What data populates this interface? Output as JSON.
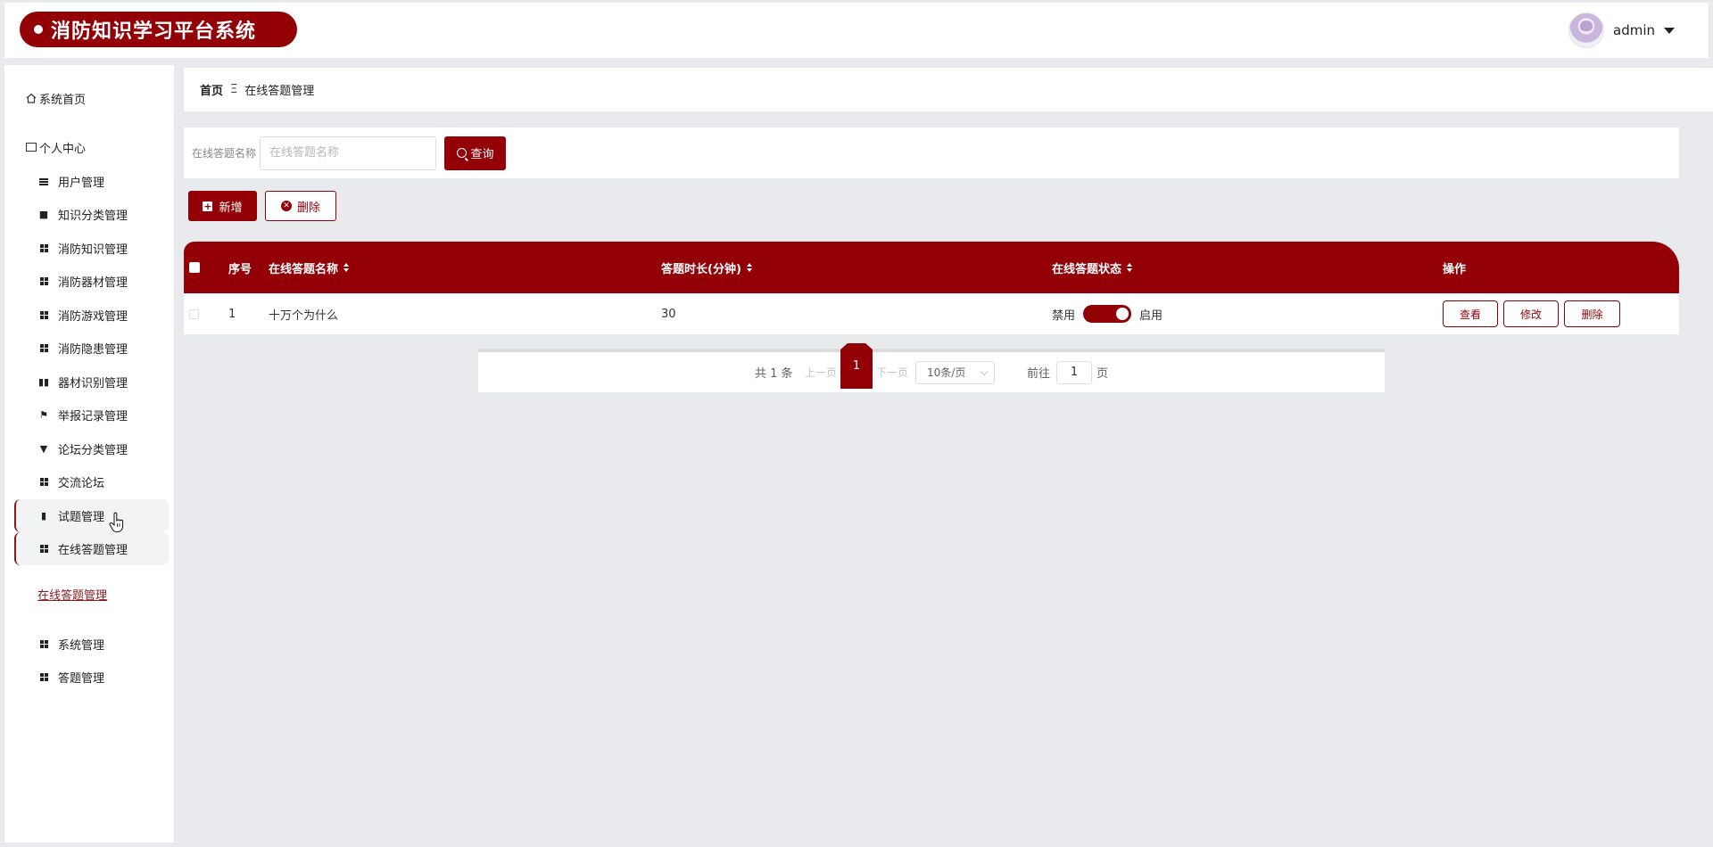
{
  "app": {
    "title": "消防知识学习平台系统"
  },
  "user": {
    "name": "admin"
  },
  "sidebar": {
    "home": "系统首页",
    "personal_center": "个人中心",
    "items": [
      {
        "label": "用户管理",
        "icon": "list-icon"
      },
      {
        "label": "知识分类管理",
        "icon": "folder-icon"
      },
      {
        "label": "消防知识管理",
        "icon": "grid-icon"
      },
      {
        "label": "消防器材管理",
        "icon": "grid-icon"
      },
      {
        "label": "消防游戏管理",
        "icon": "grid-icon"
      },
      {
        "label": "消防隐患管理",
        "icon": "grid-icon"
      },
      {
        "label": "器材识别管理",
        "icon": "chart-icon"
      },
      {
        "label": "举报记录管理",
        "icon": "flag-icon"
      },
      {
        "label": "论坛分类管理",
        "icon": "bookmark-icon"
      },
      {
        "label": "交流论坛",
        "icon": "grid-icon"
      },
      {
        "label": "试题管理",
        "icon": "bar-chart-icon"
      },
      {
        "label": "在线答题管理",
        "icon": "grid-icon"
      }
    ],
    "sub_link": "在线答题管理",
    "bottom_items": [
      {
        "label": "系统管理",
        "icon": "grid-icon"
      },
      {
        "label": "答题管理",
        "icon": "grid-icon"
      }
    ]
  },
  "breadcrumb": {
    "home": "首页",
    "separator": "Ξ",
    "current": "在线答题管理"
  },
  "search": {
    "label": "在线答题名称",
    "placeholder": "在线答题名称",
    "value": "",
    "button": "查询"
  },
  "actions": {
    "add": "新增",
    "delete": "删除"
  },
  "table": {
    "columns": [
      "序号",
      "在线答题名称",
      "答题时长(分钟)",
      "在线答题状态",
      "操作"
    ],
    "rows": [
      {
        "index": "1",
        "name": "十万个为什么",
        "duration": "30",
        "status_off": "禁用",
        "status_on": "启用",
        "enabled": true,
        "ops": [
          "查看",
          "修改",
          "删除"
        ]
      }
    ]
  },
  "pagination": {
    "total": "共 1 条",
    "prev": "上一页",
    "current": "1",
    "next": "下一页",
    "page_size": "10条/页",
    "goto_label": "前往",
    "goto_value": "1",
    "page_unit": "页"
  },
  "colors": {
    "brand": "#930006",
    "background": "#e9eaee"
  }
}
